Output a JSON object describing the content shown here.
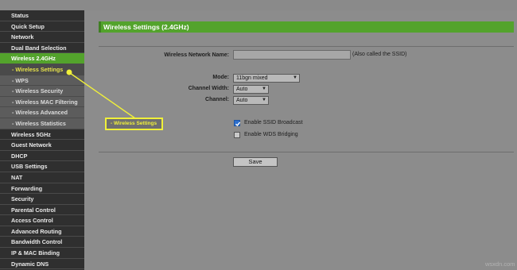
{
  "sidebar": {
    "items": [
      {
        "label": "Status",
        "type": "main"
      },
      {
        "label": "Quick Setup",
        "type": "main"
      },
      {
        "label": "Network",
        "type": "main"
      },
      {
        "label": "Dual Band Selection",
        "type": "main"
      },
      {
        "label": "Wireless 2.4GHz",
        "type": "main",
        "active": true
      },
      {
        "label": "- Wireless Settings",
        "type": "sub",
        "current": true
      },
      {
        "label": "- WPS",
        "type": "sub"
      },
      {
        "label": "- Wireless Security",
        "type": "sub"
      },
      {
        "label": "- Wireless MAC Filtering",
        "type": "sub"
      },
      {
        "label": "- Wireless Advanced",
        "type": "sub"
      },
      {
        "label": "- Wireless Statistics",
        "type": "sub"
      },
      {
        "label": "Wireless 5GHz",
        "type": "main"
      },
      {
        "label": "Guest Network",
        "type": "main"
      },
      {
        "label": "DHCP",
        "type": "main"
      },
      {
        "label": "USB Settings",
        "type": "main"
      },
      {
        "label": "NAT",
        "type": "main"
      },
      {
        "label": "Forwarding",
        "type": "main"
      },
      {
        "label": "Security",
        "type": "main"
      },
      {
        "label": "Parental Control",
        "type": "main"
      },
      {
        "label": "Access Control",
        "type": "main"
      },
      {
        "label": "Advanced Routing",
        "type": "main"
      },
      {
        "label": "Bandwidth Control",
        "type": "main"
      },
      {
        "label": "IP & MAC Binding",
        "type": "main"
      },
      {
        "label": "Dynamic DNS",
        "type": "main"
      }
    ]
  },
  "main": {
    "title": "Wireless Settings (2.4GHz)",
    "ssid": {
      "label": "Wireless Network Name:",
      "value": "",
      "hint": "(Also called the SSID)"
    },
    "mode": {
      "label": "Mode:",
      "value": "11bgn mixed"
    },
    "channel_width": {
      "label": "Channel Width:",
      "value": "Auto"
    },
    "channel": {
      "label": "Channel:",
      "value": "Auto"
    },
    "ssid_broadcast": {
      "label": "Enable SSID Broadcast",
      "checked": true
    },
    "wds_bridging": {
      "label": "Enable WDS Bridging",
      "checked": false
    },
    "save_label": "Save"
  },
  "annotation": {
    "label": "- Wireless Settings",
    "color": "#f0f03a"
  },
  "watermark": "wsxdn.com",
  "colors": {
    "accent": "#53a32c",
    "sidebar_bg": "#2f2f2f",
    "highlight": "#f0f03a"
  }
}
